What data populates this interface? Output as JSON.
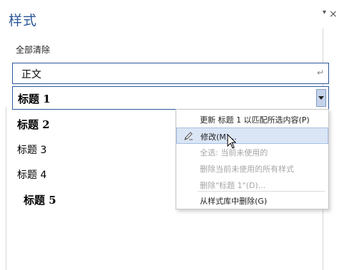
{
  "pane": {
    "title": "样式",
    "pin_glyph": "▾",
    "close_glyph": "×",
    "clear_all": "全部清除"
  },
  "styles": {
    "normal": {
      "label": "正文",
      "marker": "↵"
    },
    "heading1": {
      "label": "标题 1"
    },
    "heading2": {
      "label": "标题 2"
    },
    "heading3": {
      "label": "标题 3"
    },
    "heading4": {
      "label": "标题 4"
    },
    "heading5": {
      "label": "标题 5"
    }
  },
  "menu": {
    "items": [
      {
        "label": "更新 标题 1 以匹配所选内容(P)",
        "enabled": true
      },
      {
        "label": "修改(M)...",
        "enabled": true,
        "highlighted": true,
        "icon": "pencil-icon"
      },
      {
        "label": "全选: 当前未使用的",
        "enabled": false
      },
      {
        "label": "删除当前未使用的所有样式",
        "enabled": false
      },
      {
        "label": "删除\"标题 1\"(D)...",
        "enabled": false
      },
      {
        "label": "从样式库中删除(G)",
        "enabled": true
      }
    ]
  },
  "colors": {
    "accent": "#2b579a",
    "highlight": "#dae5f5",
    "disabled_text": "#a6a6a6"
  }
}
